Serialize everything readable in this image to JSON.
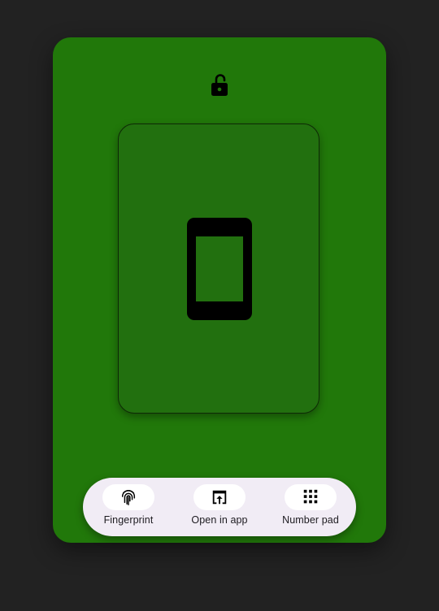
{
  "colors": {
    "background": "#222222",
    "panel": "#21780a",
    "card": "#22700f",
    "bar": "#f1ecf5",
    "icon": "#000000"
  },
  "header": {
    "icon": "lock-open-icon"
  },
  "device_card": {
    "icon": "smartphone-icon"
  },
  "bottom_bar": {
    "actions": [
      {
        "label": "Fingerprint",
        "icon": "fingerprint-icon"
      },
      {
        "label": "Open in app",
        "icon": "open-in-app-icon"
      },
      {
        "label": "Number pad",
        "icon": "dialpad-icon"
      }
    ]
  }
}
